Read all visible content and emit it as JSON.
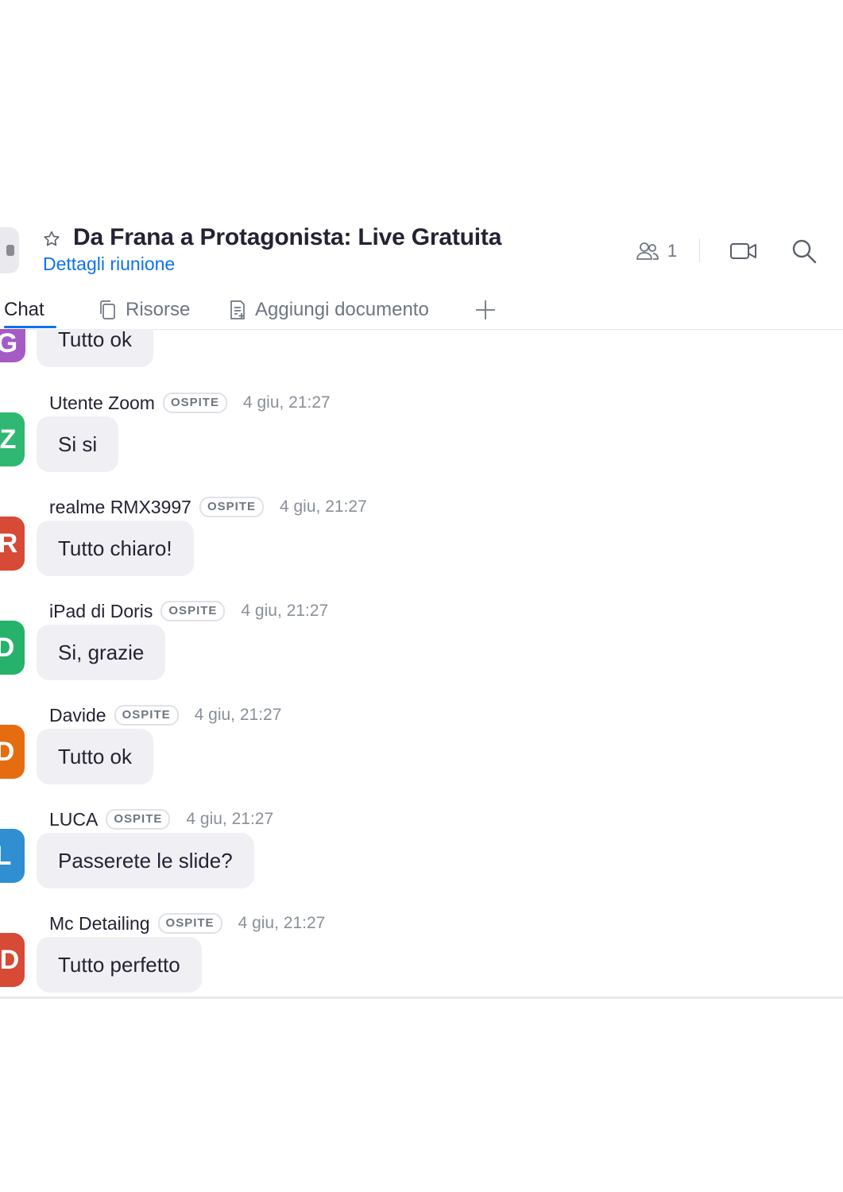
{
  "header": {
    "title": "Da Frana a Protagonista: Live Gratuita",
    "details_link": "Dettagli riunione",
    "participants_count": "1",
    "icons": {
      "favorite": "star-icon",
      "participants": "people-icon",
      "video": "video-camera-icon",
      "search": "search-icon"
    }
  },
  "tabs": [
    {
      "label": "Chat",
      "active": true
    },
    {
      "label": "Risorse",
      "icon": "files-icon"
    },
    {
      "label": "Aggiungi documento",
      "icon": "add-document-icon"
    },
    {
      "label": "",
      "icon": "plus-icon"
    }
  ],
  "messages": [
    {
      "initial": "G",
      "color": "#a55bc6",
      "sender": "",
      "badge": "",
      "time": "",
      "text": "Tutto ok"
    },
    {
      "initial": "Z",
      "color": "#2eb872",
      "sender": "Utente Zoom",
      "badge": "OSPITE",
      "time": "4 giu, 21:27",
      "text": "Si si"
    },
    {
      "initial": "R",
      "color": "#d64a36",
      "sender": "realme RMX3997",
      "badge": "OSPITE",
      "time": "4 giu, 21:27",
      "text": "Tutto chiaro!"
    },
    {
      "initial": "D",
      "color": "#27b26b",
      "sender": "iPad di Doris",
      "badge": "OSPITE",
      "time": "4 giu, 21:27",
      "text": "Si, grazie"
    },
    {
      "initial": "D",
      "color": "#e56d0f",
      "sender": "Davide",
      "badge": "OSPITE",
      "time": "4 giu, 21:27",
      "text": "Tutto ok"
    },
    {
      "initial": "L",
      "color": "#2f8fd0",
      "sender": "LUCA",
      "badge": "OSPITE",
      "time": "4 giu, 21:27",
      "text": "Passerete le slide?"
    },
    {
      "initial": "D",
      "color": "#d64a36",
      "sender": "Mc Detailing",
      "badge": "OSPITE",
      "time": "4 giu, 21:27",
      "text": "Tutto perfetto"
    }
  ],
  "colors": {
    "accent": "#0e72ed",
    "bubble": "#f0f0f4",
    "text": "#232333",
    "muted": "#6e7680"
  }
}
